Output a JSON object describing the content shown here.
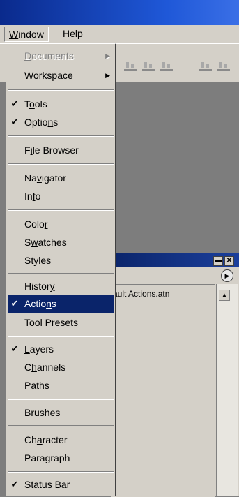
{
  "menubar": {
    "window": {
      "pre": "",
      "key": "W",
      "post": "indow"
    },
    "help": {
      "pre": "",
      "key": "H",
      "post": "elp"
    }
  },
  "window_menu": {
    "documents": {
      "pre": "",
      "key": "D",
      "post": "ocuments"
    },
    "workspace": {
      "pre": "Wor",
      "key": "k",
      "post": "space"
    },
    "tools": {
      "pre": "T",
      "key": "o",
      "post": "ols"
    },
    "options": {
      "pre": "Optio",
      "key": "n",
      "post": "s"
    },
    "file_browser": {
      "pre": "F",
      "key": "i",
      "post": "le Browser"
    },
    "navigator": {
      "pre": "Na",
      "key": "v",
      "post": "igator"
    },
    "info": {
      "pre": "In",
      "key": "f",
      "post": "o"
    },
    "color": {
      "pre": "Colo",
      "key": "r",
      "post": ""
    },
    "swatches": {
      "pre": "S",
      "key": "w",
      "post": "atches"
    },
    "styles": {
      "pre": "Sty",
      "key": "l",
      "post": "es"
    },
    "history": {
      "pre": "Histor",
      "key": "y",
      "post": ""
    },
    "actions": {
      "pre": "Actio",
      "key": "n",
      "post": "s"
    },
    "tool_presets": {
      "pre": "",
      "key": "T",
      "post": "ool Presets"
    },
    "layers": {
      "pre": "",
      "key": "L",
      "post": "ayers"
    },
    "channels": {
      "pre": "C",
      "key": "h",
      "post": "annels"
    },
    "paths": {
      "pre": "",
      "key": "P",
      "post": "aths"
    },
    "brushes": {
      "pre": "",
      "key": "B",
      "post": "rushes"
    },
    "character": {
      "pre": "Ch",
      "key": "a",
      "post": "racter"
    },
    "paragraph": {
      "pre": "Para",
      "key": "g",
      "post": "raph"
    },
    "status_bar": {
      "pre": "Stat",
      "key": "u",
      "post": "s Bar"
    },
    "check": "✔",
    "arrow": "▶"
  },
  "actions_panel": {
    "set_name": "ault Actions.atn",
    "minimize_glyph": "▬",
    "close_glyph": "✕",
    "menu_glyph": "▶",
    "scroll_up_glyph": "▲"
  },
  "colors": {
    "menu_bg": "#d4d0c8",
    "highlight": "#0a246a",
    "titlebar": "#1f58d8"
  }
}
